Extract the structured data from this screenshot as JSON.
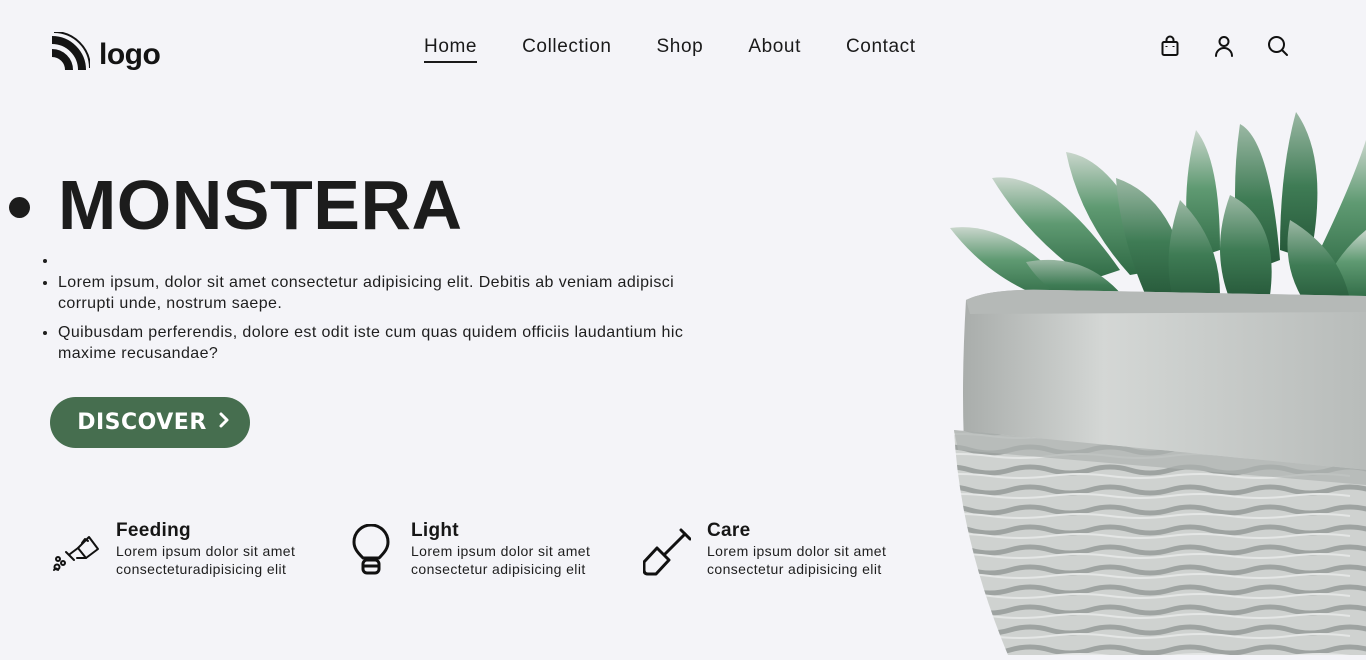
{
  "logo": {
    "text": "logo"
  },
  "nav": {
    "items": [
      {
        "label": "Home",
        "active": true
      },
      {
        "label": "Collection",
        "active": false
      },
      {
        "label": "Shop",
        "active": false
      },
      {
        "label": "About",
        "active": false
      },
      {
        "label": "Contact",
        "active": false
      }
    ],
    "icons": [
      "shopping-bag-icon",
      "user-icon",
      "search-icon"
    ]
  },
  "hero": {
    "title": "MONSTERA",
    "paragraphs": [
      "Lorem ipsum, dolor sit amet consectetur adipisicing elit. Debitis ab veniam adipisci corrupti unde, nostrum saepe.",
      "Quibusdam perferendis, dolore est odit iste cum quas quidem officiis laudantium hic maxime recusandae?"
    ],
    "button_label": "DISCOVER"
  },
  "features": [
    {
      "title": "Feeding",
      "desc_line1": "Lorem ipsum dolor sit amet",
      "desc_line2": "consecteturadipisicing elit",
      "icon": "watering-can-icon"
    },
    {
      "title": "Light",
      "desc_line1": "Lorem ipsum dolor sit amet",
      "desc_line2": "consectetur adipisicing elit",
      "icon": "lightbulb-icon"
    },
    {
      "title": "Care",
      "desc_line1": "Lorem ipsum dolor sit amet",
      "desc_line2": "consectetur adipisicing elit",
      "icon": "shovel-icon"
    }
  ],
  "colors": {
    "background": "#f4f4f8",
    "accent": "#466e4f",
    "text": "#1a1a1a"
  }
}
